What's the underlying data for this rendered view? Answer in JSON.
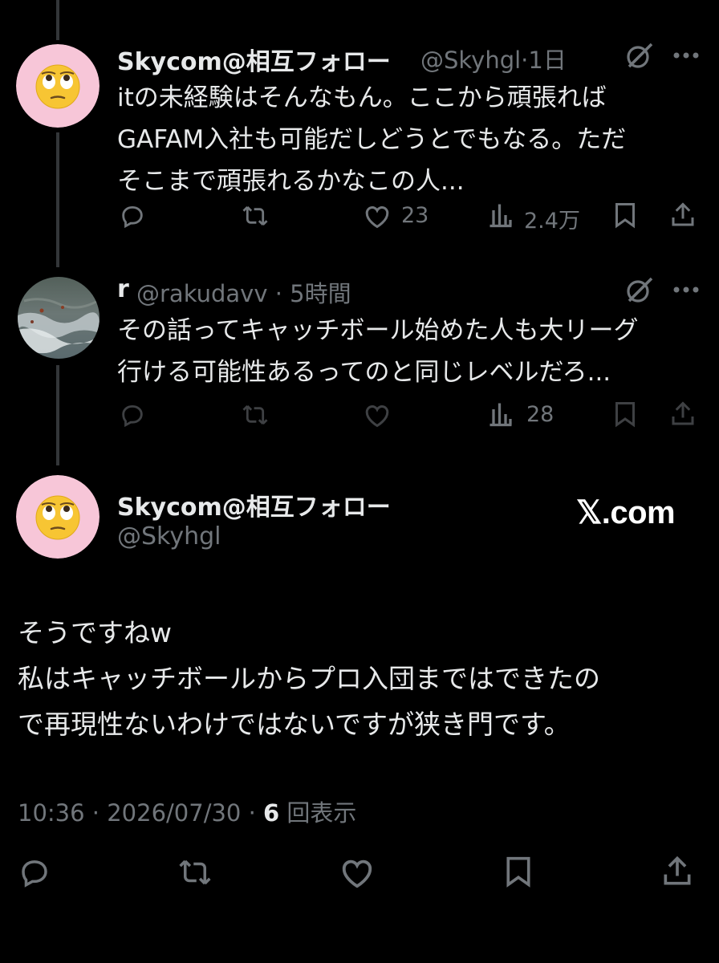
{
  "reply1": {
    "display_name": "Skycom@相互フォロー",
    "handle_time": "@Skyhgl·1日",
    "text_lines": [
      "itの未経験はそんなもん。ここから頑張れば",
      "GAFAM入社も可能だしどうとでもなる。ただ",
      "そこまで頑張れるかなこの人..."
    ],
    "likes": "23",
    "views": "2.4万",
    "avatar_icon": "face-rolling-eyes-emoji",
    "avatar_bg": "#f7c6d8"
  },
  "reply2": {
    "display_name": "r",
    "handle_time": "@rakudavv · 5時間",
    "text_lines": [
      "その話ってキャッチボール始めた人も大リーグ",
      "行ける可能性あるってのと同じレベルだろ..."
    ],
    "views": "28",
    "avatar_icon": "sea-waves-photo"
  },
  "main": {
    "display_name": "Skycom@相互フォロー",
    "handle": "@Skyhgl",
    "watermark": "𝕏.com",
    "text_lines": [
      "そうですねw",
      "私はキャッチボールからプロ入団まではできたの",
      "で再現性ないわけではないですが狭き門です。"
    ],
    "timestamp": "10:36 · 2026/07/30 · ",
    "views_count": "6",
    "views_label": " 回表示"
  },
  "colors": {
    "background": "#000000",
    "text_primary": "#e7e9ea",
    "text_secondary": "#71767b",
    "thread_line": "#333639"
  }
}
